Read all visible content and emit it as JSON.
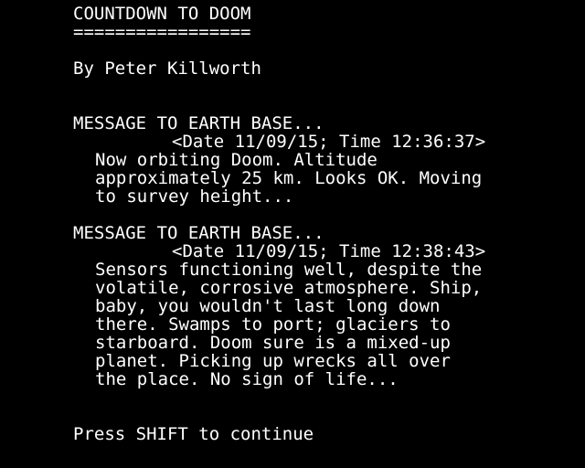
{
  "screen": {
    "background": "#000000",
    "foreground": "#ffffff",
    "title": "COUNTDOWN TO DOOM",
    "title_underline": "=================",
    "author": "By Peter Killworth",
    "messages": [
      {
        "heading": "MESSAGE TO EARTH BASE...",
        "timestamp": "<Date 11/09/15; Time 12:36:37>",
        "body": [
          "Now orbiting Doom. Altitude",
          "approximately 25 km. Looks OK. Moving",
          "to survey height..."
        ]
      },
      {
        "heading": "MESSAGE TO EARTH BASE...",
        "timestamp": "<Date 11/09/15; Time 12:38:43>",
        "body": [
          "Sensors functioning well, despite the",
          "volatile, corrosive atmosphere. Ship,",
          "baby, you wouldn't last long down",
          "there. Swamps to port; glaciers to",
          "starboard. Doom sure is a mixed-up",
          "planet. Picking up wrecks all over",
          "the place. No sign of life..."
        ]
      }
    ],
    "prompt": "Press SHIFT to continue"
  }
}
